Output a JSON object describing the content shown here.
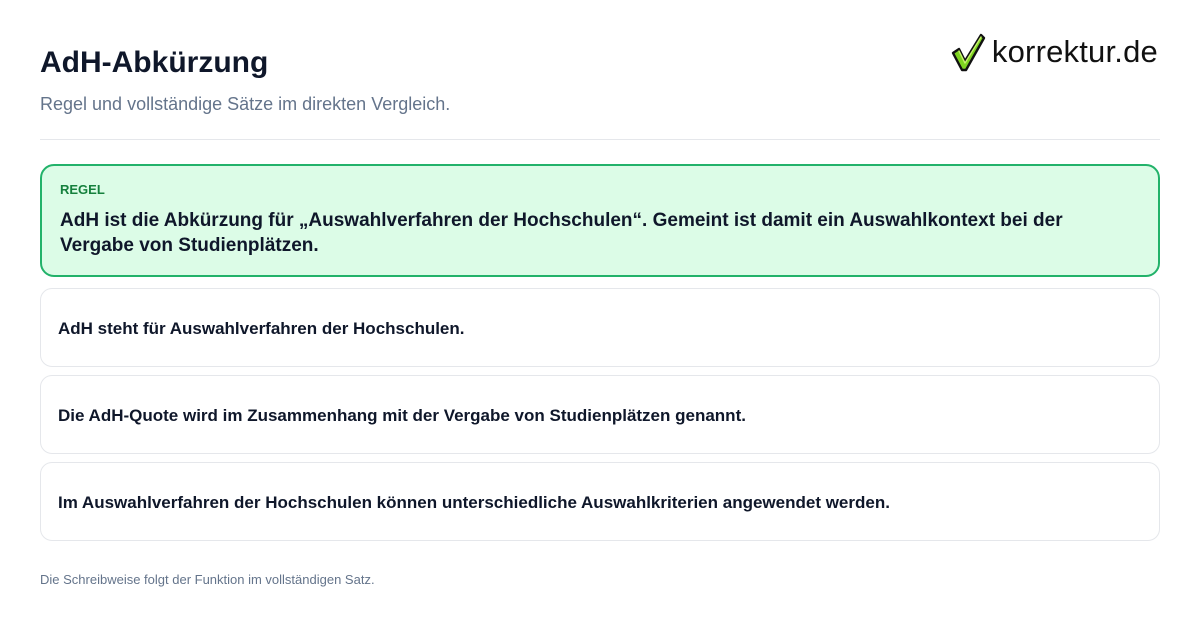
{
  "header": {
    "title": "AdH-Abkürzung",
    "subtitle": "Regel und vollständige Sätze im direkten Vergleich."
  },
  "logo": {
    "text": "korrektur.de",
    "icon": "checkmark-icon",
    "color": "#7ed321"
  },
  "rule": {
    "label": "REGEL",
    "text": "AdH ist die Abkürzung für „Auswahlverfahren der Hochschulen“. Gemeint ist damit ein Auswahlkontext bei der Vergabe von Studienplätzen."
  },
  "examples": [
    {
      "text": "AdH steht für Auswahlverfahren der Hochschulen."
    },
    {
      "text": "Die AdH-Quote wird im Zusammenhang mit der Vergabe von Studienplätzen genannt."
    },
    {
      "text": "Im Auswahlverfahren der Hochschulen können unterschiedliche Auswahlkriterien angewendet werden."
    }
  ],
  "footer": {
    "note": "Die Schreibweise folgt der Funktion im vollständigen Satz."
  },
  "colors": {
    "rule_border": "#22b26a",
    "rule_background": "#dcfce7",
    "rule_label": "#15803d",
    "text": "#0f172a",
    "muted": "#64748b"
  }
}
